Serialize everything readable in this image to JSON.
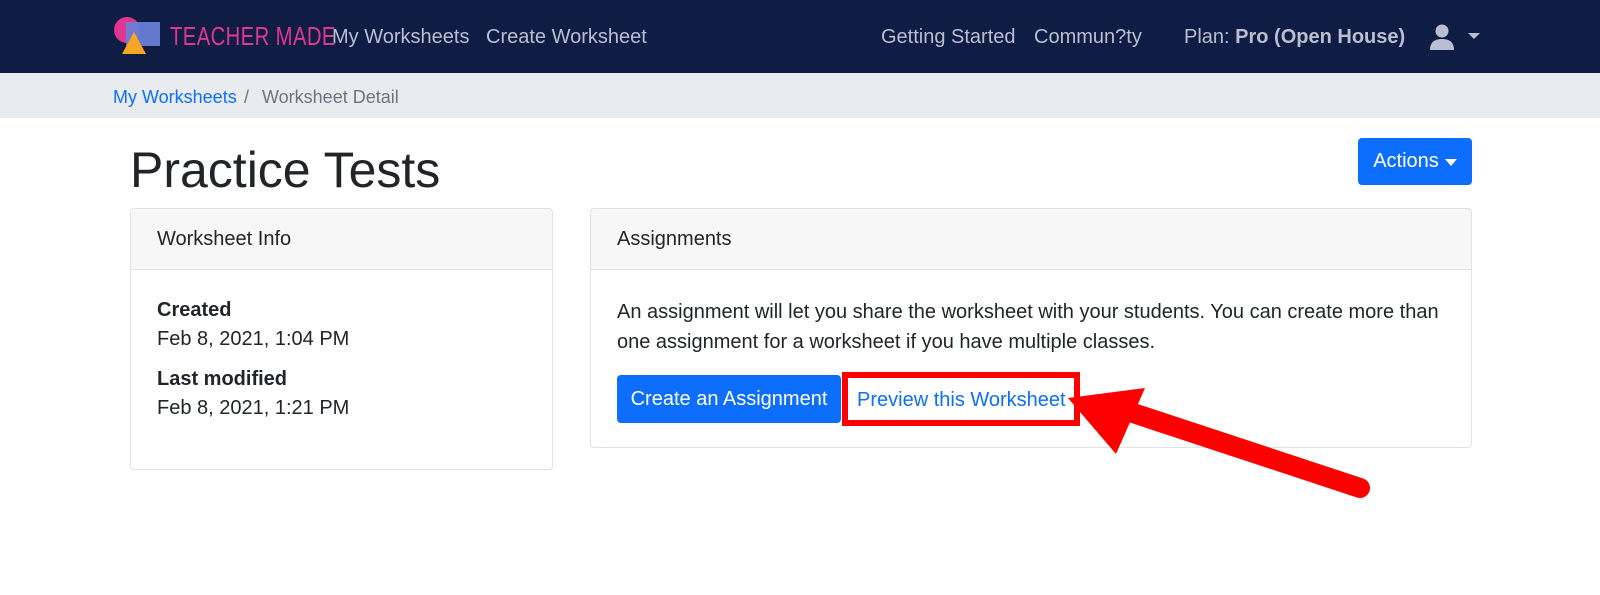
{
  "navbar": {
    "logo_text": "TEACHER MADE",
    "links": {
      "my_worksheets": "My Worksheets",
      "create_worksheet": "Create Worksheet",
      "getting_started": "Getting Started",
      "community": "Commun?ty"
    },
    "plan_label": "Plan:",
    "plan_value": "Pro (Open House)",
    "user_icon": "user-icon"
  },
  "breadcrumb": {
    "link": "My Worksheets",
    "separator": "/",
    "current": "Worksheet Detail"
  },
  "page": {
    "title": "Practice Tests",
    "actions_label": "Actions"
  },
  "worksheet_info": {
    "header": "Worksheet Info",
    "created_label": "Created",
    "created_value": "Feb 8, 2021, 1:04 PM",
    "modified_label": "Last modified",
    "modified_value": "Feb 8, 2021, 1:21 PM"
  },
  "assignments": {
    "header": "Assignments",
    "description": "An assignment will let you share the worksheet with your students. You can create more than one assignment for a worksheet if you have multiple classes.",
    "create_label": "Create an Assignment",
    "preview_label": "Preview this Worksheet"
  },
  "colors": {
    "navbar": "#0f1d44",
    "primary": "#0d6efd",
    "logo_pink": "#e0368f",
    "annotation_red": "#ff0000"
  }
}
